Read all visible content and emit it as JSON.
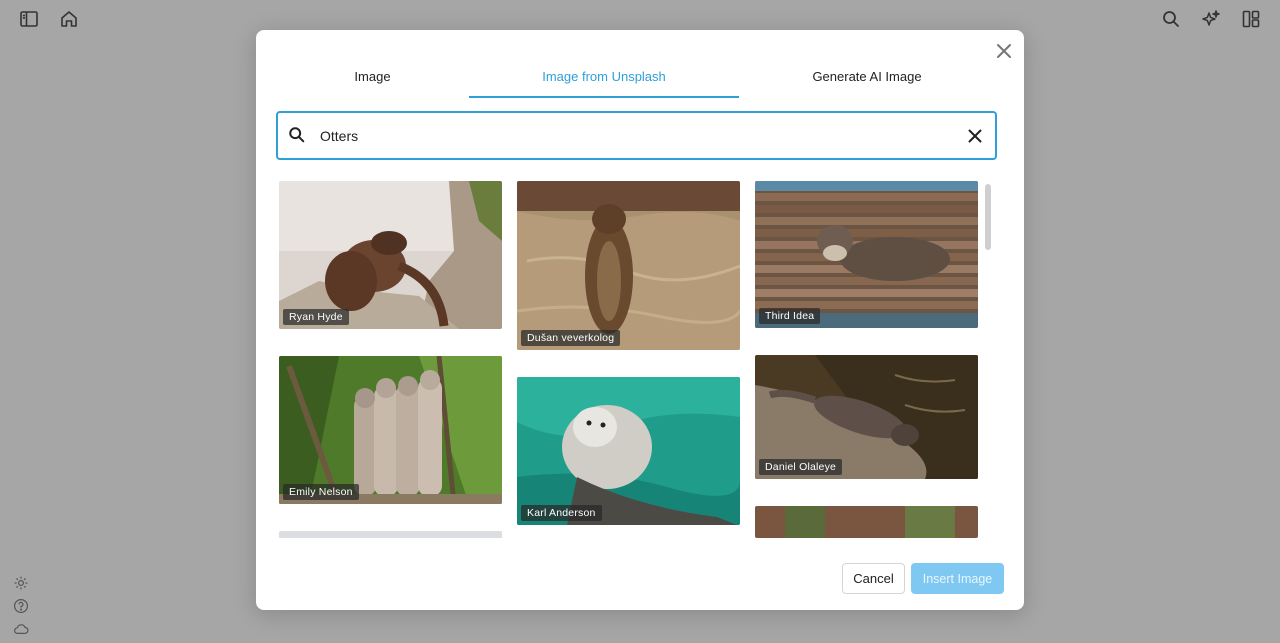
{
  "dialog": {
    "tabs": [
      {
        "label": "Image"
      },
      {
        "label": "Image from Unsplash"
      },
      {
        "label": "Generate AI Image"
      }
    ],
    "active_tab": 1,
    "search": {
      "value": "Otters"
    },
    "results": [
      {
        "credit": "Ryan Hyde"
      },
      {
        "credit": "Dušan veverkolog"
      },
      {
        "credit": "Third Idea"
      },
      {
        "credit": "Emily Nelson"
      },
      {
        "credit": "Karl Anderson"
      },
      {
        "credit": "Daniel Olaleye"
      }
    ],
    "cancel_label": "Cancel",
    "insert_label": "Insert Image"
  },
  "colors": {
    "accent": "#2f9fd8",
    "insert_button_bg": "#7fc8f2",
    "overlay": "#a6a6a6"
  }
}
